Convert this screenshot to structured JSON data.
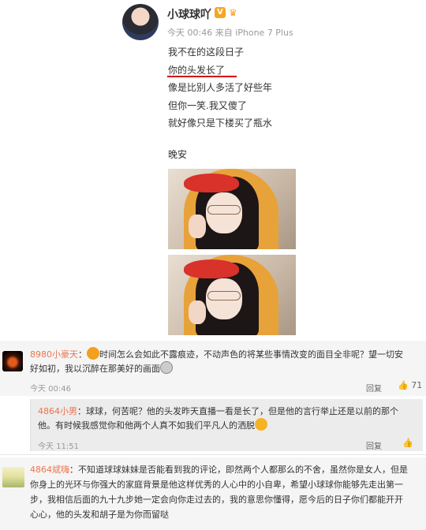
{
  "post": {
    "username": "小球球吖",
    "badge": "V",
    "meta": "今天 00:46 来自 iPhone 7 Plus",
    "lines": [
      "我不在的这段日子",
      "你的头发长了",
      "像是比别人多活了好些年",
      "但你一笑.我又傻了",
      "就好像只是下楼买了瓶水"
    ],
    "goodnight": "晚安"
  },
  "comments": [
    {
      "name": "8980小豪天",
      "sep": "：",
      "text_line1": "时间怎么会如此不露痕迹，不动声色的将某些事情改变的面目全非呢？望一切安",
      "text_line2": "好如初，我以沉醉在那美好的画面",
      "time": "今天 00:46",
      "reply_label": "回复",
      "likes": "71"
    },
    {
      "name": "4864小男",
      "sep": "：",
      "text_line1": "球球，何苦呢？他的头发昨天直播一看是长了，但是他的言行举止还是以前的那个",
      "text_line2": "他。有时候我感觉你和他两个人真不如我们平凡人的洒脱",
      "time": "今天 11:51",
      "reply_label": "回复"
    },
    {
      "name": "4864斌嗨",
      "sep": "：",
      "text_line1": "不知道球球妹妹是否能看到我的评论，即然两个人都那么的不舍，虽然你是女人，但是",
      "text_line2": "你身上的光环与你强大的家庭背景是他这样优秀的人心中的小自卑，希望小球球你能够先走出第一",
      "text_line3": "步，我相信后面的九十九步她一定会向你走过去的，我的意思你懂得，愿今后的日子你们都能开开",
      "text_line4": "心心，他的头发和胡子是为你而留哒"
    }
  ],
  "colors": {
    "accent": "#eb7350",
    "underline": "#d0021b",
    "badge": "#f5a623"
  }
}
